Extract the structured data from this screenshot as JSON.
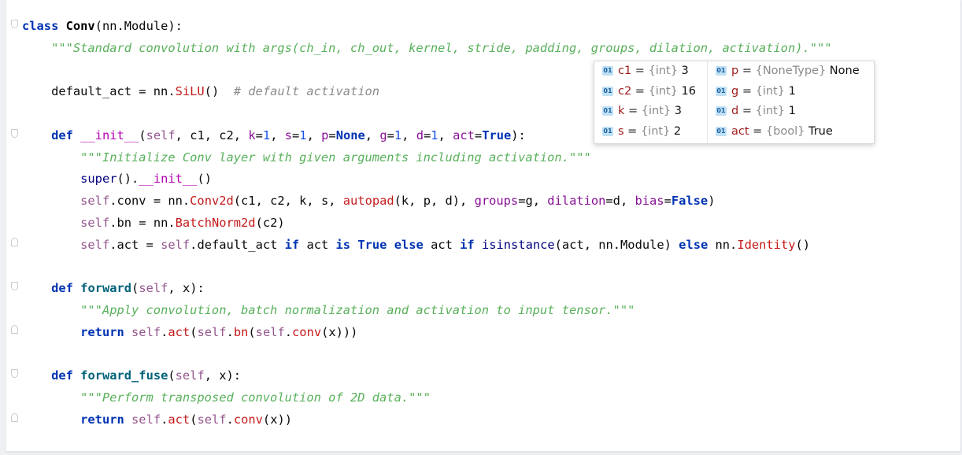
{
  "code_lines": [
    "class Conv(nn.Module):",
    "    \"\"\"Standard convolution with args(ch_in, ch_out, kernel, stride, padding, groups, dilation, activation).\"\"\"",
    "",
    "    default_act = nn.SiLU()  # default activation",
    "",
    "    def __init__(self, c1, c2, k=1, s=1, p=None, g=1, d=1, act=True):",
    "        \"\"\"Initialize Conv layer with given arguments including activation.\"\"\"",
    "        super().__init__()",
    "        self.conv = nn.Conv2d(c1, c2, k, s, autopad(k, p, d), groups=g, dilation=d, bias=False)",
    "        self.bn = nn.BatchNorm2d(c2)",
    "        self.act = self.default_act if act is True else act if isinstance(act, nn.Module) else nn.Identity()",
    "",
    "    def forward(self, x):",
    "        \"\"\"Apply convolution, batch normalization and activation to input tensor.\"\"\"",
    "        return self.act(self.bn(self.conv(x)))",
    "",
    "    def forward_fuse(self, x):",
    "        \"\"\"Perform transposed convolution of 2D data.\"\"\"",
    "        return self.act(self.conv(x))"
  ],
  "debug_popup": {
    "badge": "01",
    "left": [
      {
        "name": "c1",
        "eq": " = ",
        "type": "{int}",
        "value": "3"
      },
      {
        "name": "c2",
        "eq": " = ",
        "type": "{int}",
        "value": "16"
      },
      {
        "name": "k",
        "eq": " = ",
        "type": "{int}",
        "value": "3"
      },
      {
        "name": "s",
        "eq": " = ",
        "type": "{int}",
        "value": "2"
      }
    ],
    "right": [
      {
        "name": "p",
        "eq": " = ",
        "type": "{NoneType}",
        "value": "None"
      },
      {
        "name": "g",
        "eq": " = ",
        "type": "{int}",
        "value": "1"
      },
      {
        "name": "d",
        "eq": " = ",
        "type": "{int}",
        "value": "1"
      },
      {
        "name": "act",
        "eq": " = ",
        "type": "{bool}",
        "value": "True"
      }
    ]
  },
  "colors": {
    "keyword": "#0033b3",
    "function_def": "#00627a",
    "self": "#94558d",
    "number": "#1750eb",
    "call": "#c41a1a",
    "kwarg": "#871094",
    "docstring": "#58b05a",
    "comment": "#8c8c8c"
  },
  "icons": {
    "fold_marker": "fold-marker-icon",
    "variable_badge": "variable-badge-icon"
  }
}
